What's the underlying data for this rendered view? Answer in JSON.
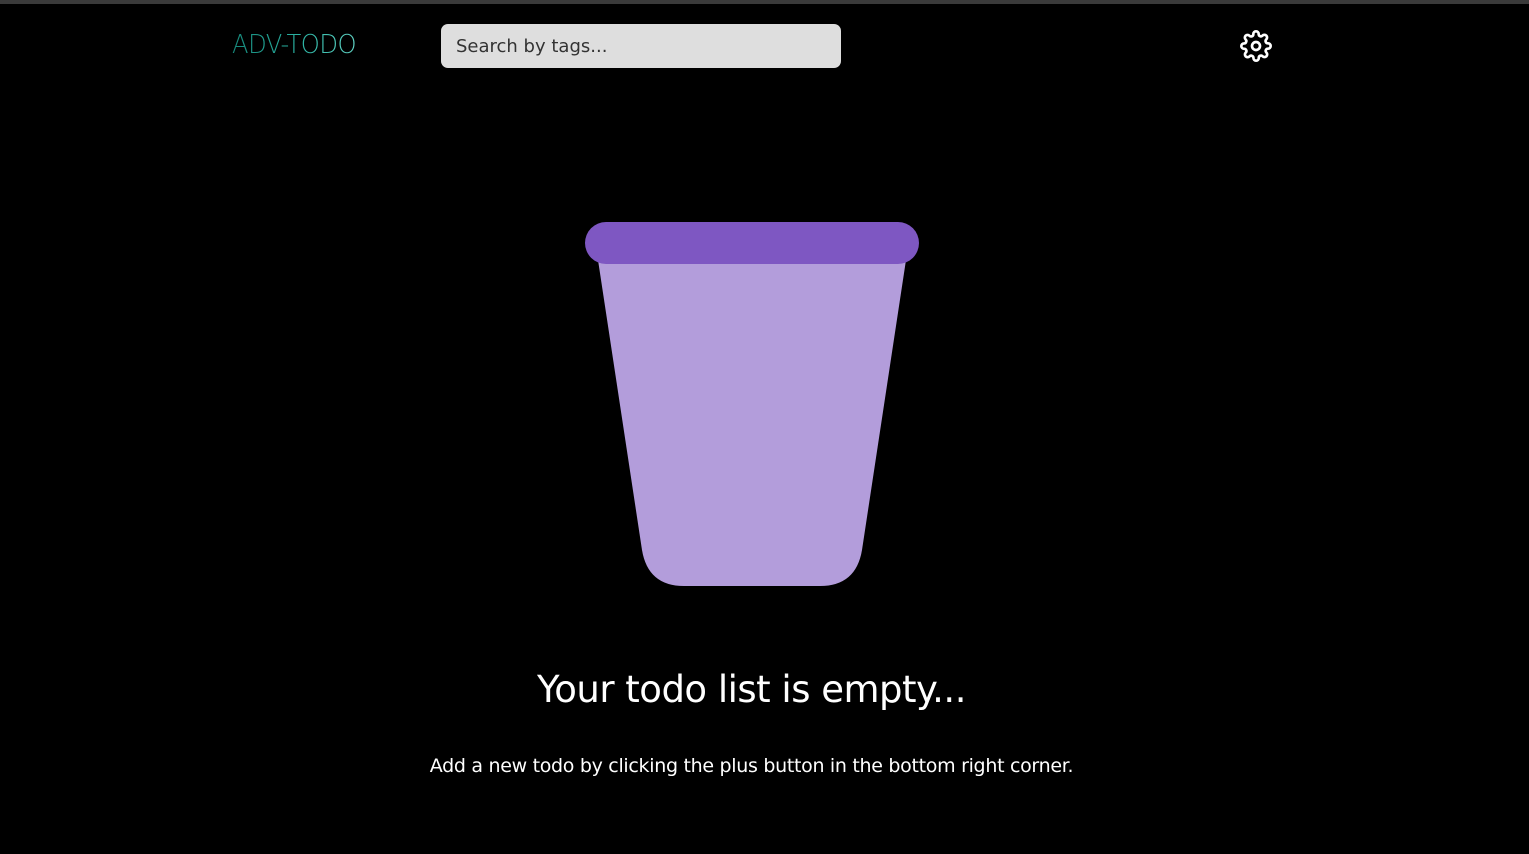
{
  "app": {
    "logo_text": "ADV-TODO"
  },
  "header": {
    "search_placeholder": "Search by tags...",
    "settings_icon": "gear-icon"
  },
  "empty_state": {
    "illustration_icon": "empty-cup-icon",
    "title": "Your todo list is empty...",
    "hint": "Add a new todo by clicking the plus button in the bottom right corner."
  },
  "colors": {
    "background": "#000000",
    "search_bg": "#dedede",
    "logo_teal": "#2bb3a3",
    "cup_rim": "#7e57c2",
    "cup_body": "#b39ddb",
    "text": "#ffffff"
  }
}
